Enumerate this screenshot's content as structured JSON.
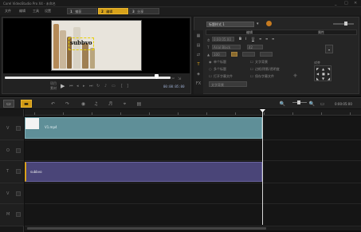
{
  "title": "Corel VideoStudio Pro X4 - 未命名",
  "menu": {
    "file": "文件",
    "edit": "编辑",
    "tools": "工具",
    "settings": "设置"
  },
  "steps": [
    {
      "num": "1",
      "label": "捕获"
    },
    {
      "num": "2",
      "label": "编辑"
    },
    {
      "num": "3",
      "label": "分享"
    }
  ],
  "preview": {
    "caption": "subbvo",
    "project_label": "项目",
    "clip_label": "素材",
    "timecode": "00:00:05:00"
  },
  "options": {
    "style_select": "标题样式 1",
    "tab_edit": "编辑",
    "tab_attr": "属性",
    "duration_label": "0:00:05:00",
    "font_label": "Arial Black",
    "size_value": "42",
    "line_value": "100",
    "opt1": "单个标题",
    "opt2": "多个标题",
    "opt3": "文字背景",
    "opt4": "边框/阴影/透明度",
    "opt5": "打开字幕文件",
    "opt6": "保存字幕文件",
    "align_label": "对齐",
    "bg_label": "文字背景"
  },
  "timeline": {
    "video_clip_label": "V1.mp4",
    "title_clip_label": "subbvo",
    "track_labels": [
      "V",
      "O",
      "T",
      "V",
      "M"
    ]
  },
  "colors": {
    "accent": "#d8a21a",
    "video_clip": "#5f8f98",
    "title_clip": "#4a4578"
  }
}
